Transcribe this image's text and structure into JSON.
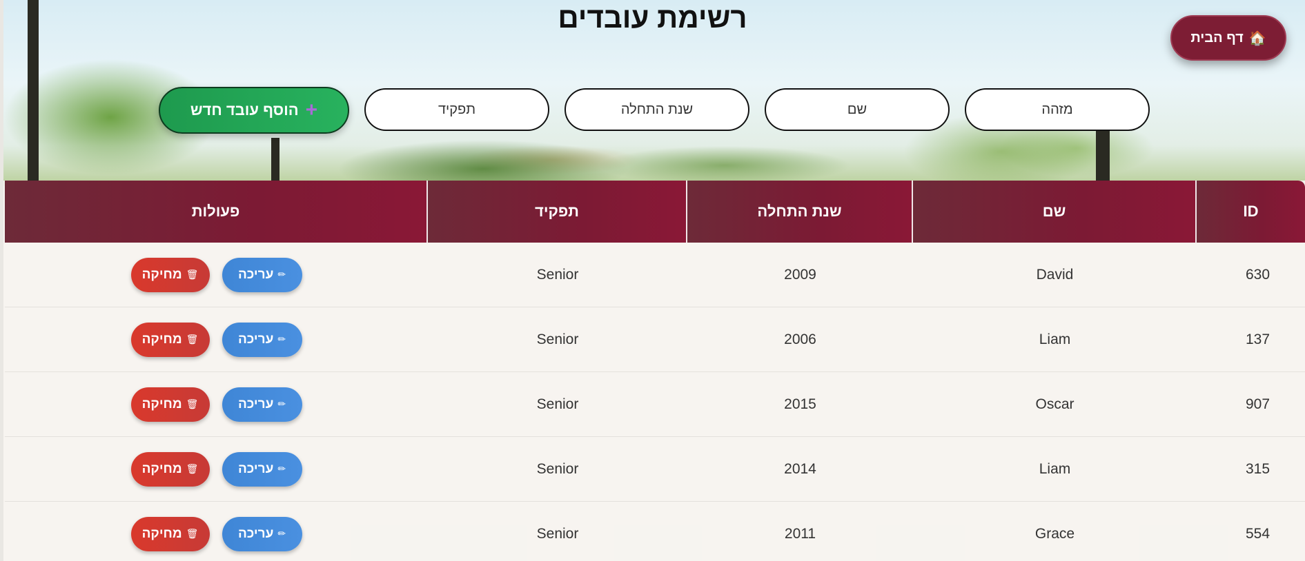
{
  "page": {
    "title": "רשימת עובדים",
    "home_button": {
      "icon": "🏠",
      "label": "דף הבית"
    }
  },
  "filters": [
    {
      "key": "id",
      "placeholder": "מזהה"
    },
    {
      "key": "name",
      "placeholder": "שם"
    },
    {
      "key": "start_year",
      "placeholder": "שנת התחלה"
    },
    {
      "key": "role",
      "placeholder": "תפקיד"
    }
  ],
  "add_button": {
    "icon": "+",
    "label": "הוסף עובד חדש"
  },
  "table": {
    "headers": {
      "id": "ID",
      "name": "שם",
      "start_year": "שנת התחלה",
      "role": "תפקיד",
      "actions": "פעולות"
    },
    "action_labels": {
      "edit": "עריכה",
      "edit_icon": "✏",
      "delete": "מחיקה",
      "delete_icon": "🗑"
    },
    "rows": [
      {
        "id": "630",
        "name": "David",
        "start_year": "2009",
        "role": "Senior"
      },
      {
        "id": "137",
        "name": "Liam",
        "start_year": "2006",
        "role": "Senior"
      },
      {
        "id": "907",
        "name": "Oscar",
        "start_year": "2015",
        "role": "Senior"
      },
      {
        "id": "315",
        "name": "Liam",
        "start_year": "2014",
        "role": "Senior"
      },
      {
        "id": "554",
        "name": "Grace",
        "start_year": "2011",
        "role": "Senior"
      }
    ]
  },
  "colors": {
    "header_bg": "#7c1a34",
    "home_btn": "#7d1d34",
    "add_btn": "#1e9a4e",
    "edit_btn": "#4a90e0",
    "delete_btn": "#d9392c"
  }
}
